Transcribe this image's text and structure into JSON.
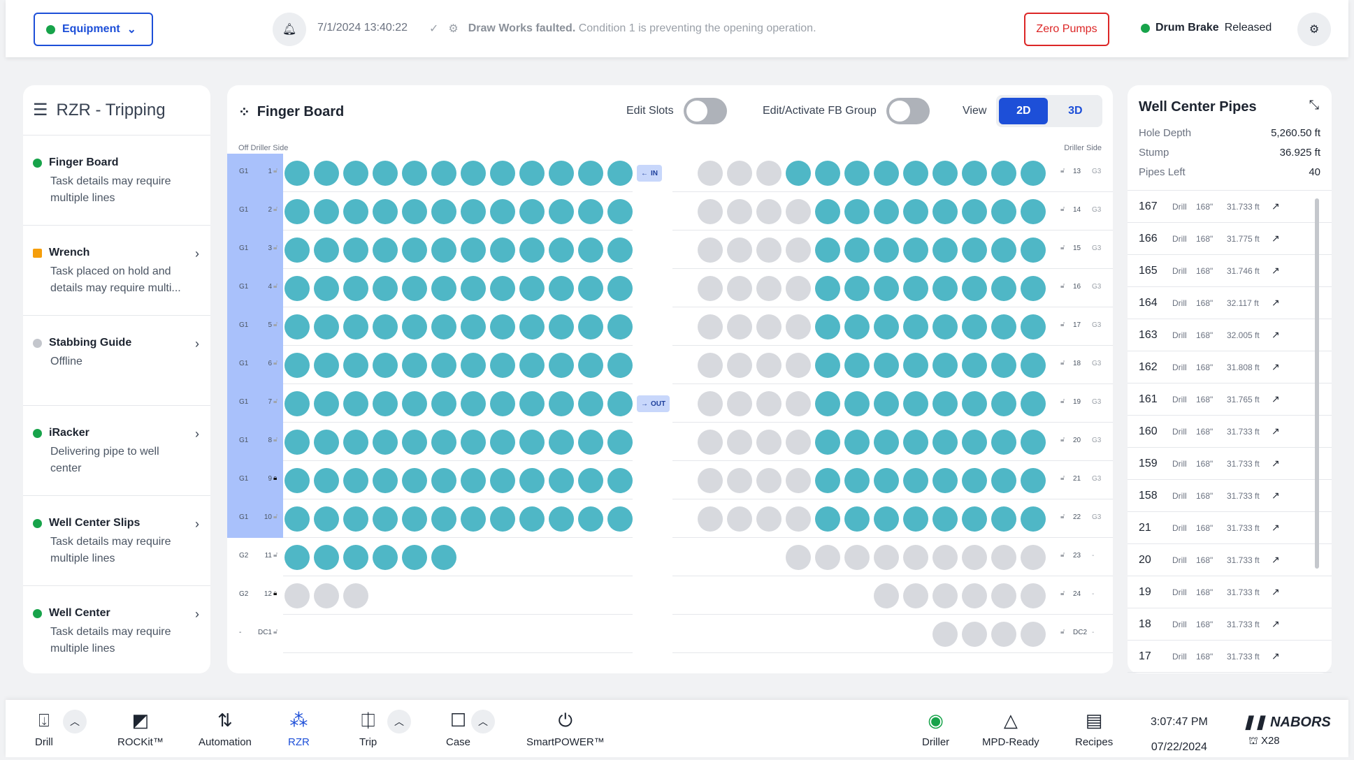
{
  "header": {
    "equipment_label": "Equipment",
    "timestamp": "7/1/2024  13:40:22",
    "fault_title": "Draw Works faulted.",
    "fault_detail": "Condition 1 is preventing the opening operation.",
    "zero_pumps": "Zero Pumps",
    "drum_label": "Drum Brake",
    "drum_state": "Released"
  },
  "left": {
    "title": "RZR - Tripping",
    "items": [
      {
        "title": "Finger Board",
        "desc": "Task details may require multiple lines",
        "status": "green"
      },
      {
        "title": "Wrench",
        "desc": "Task placed on hold and details may require multi...",
        "status": "orange"
      },
      {
        "title": "Stabbing Guide",
        "desc": "Offline",
        "status": "gray"
      },
      {
        "title": "iRacker",
        "desc": "Delivering pipe to well center",
        "status": "green"
      },
      {
        "title": "Well Center Slips",
        "desc": "Task details may require multiple lines",
        "status": "green"
      },
      {
        "title": "Well Center",
        "desc": "Task details may require multiple lines",
        "status": "green"
      }
    ]
  },
  "fingerboard": {
    "title": "Finger Board",
    "edit_slots": "Edit Slots",
    "edit_group": "Edit/Activate FB Group",
    "view": "View",
    "view_2d": "2D",
    "view_3d": "3D",
    "off_driller": "Off Driller Side",
    "driller": "Driller Side",
    "tag_in": "IN",
    "tag_out": "OUT",
    "rows": [
      {
        "g": "G1",
        "n": "1",
        "lock": "open",
        "lt": 12,
        "rg": 3,
        "rt": 9,
        "rn": "13",
        "rgp": "G3",
        "hl": true
      },
      {
        "g": "G1",
        "n": "2",
        "lock": "open",
        "lt": 12,
        "rg": 4,
        "rt": 8,
        "rn": "14",
        "rgp": "G3",
        "hl": true
      },
      {
        "g": "G1",
        "n": "3",
        "lock": "open",
        "lt": 12,
        "rg": 4,
        "rt": 8,
        "rn": "15",
        "rgp": "G3",
        "hl": true
      },
      {
        "g": "G1",
        "n": "4",
        "lock": "open",
        "lt": 12,
        "rg": 4,
        "rt": 8,
        "rn": "16",
        "rgp": "G3",
        "hl": true
      },
      {
        "g": "G1",
        "n": "5",
        "lock": "open",
        "lt": 12,
        "rg": 4,
        "rt": 8,
        "rn": "17",
        "rgp": "G3",
        "hl": true
      },
      {
        "g": "G1",
        "n": "6",
        "lock": "open",
        "lt": 12,
        "rg": 4,
        "rt": 8,
        "rn": "18",
        "rgp": "G3",
        "hl": true
      },
      {
        "g": "G1",
        "n": "7",
        "lock": "open",
        "lt": 12,
        "rg": 4,
        "rt": 8,
        "rn": "19",
        "rgp": "G3",
        "hl": true
      },
      {
        "g": "G1",
        "n": "8",
        "lock": "open",
        "lt": 12,
        "rg": 4,
        "rt": 8,
        "rn": "20",
        "rgp": "G3",
        "hl": true
      },
      {
        "g": "G1",
        "n": "9",
        "lock": "closed",
        "lt": 12,
        "rg": 4,
        "rt": 8,
        "rn": "21",
        "rgp": "G3",
        "hl": true
      },
      {
        "g": "G1",
        "n": "10",
        "lock": "open",
        "lt": 12,
        "rg": 4,
        "rt": 8,
        "rn": "22",
        "rgp": "G3",
        "hl": true
      },
      {
        "g": "G2",
        "n": "11",
        "lock": "open",
        "lt": 6,
        "rg": 9,
        "rt": 0,
        "rn": "23",
        "rgp": "-",
        "hl": false
      },
      {
        "g": "G2",
        "n": "12",
        "lock": "closed",
        "lt": 0,
        "lg": 3,
        "rg": 6,
        "rt": 0,
        "rn": "24",
        "rgp": "-",
        "hl": false
      },
      {
        "g": "-",
        "n": "DC1",
        "lock": "open",
        "lt": 0,
        "rg": 4,
        "rt": 0,
        "rn": "DC2",
        "rgp": "-",
        "hl": false
      }
    ]
  },
  "wellcenter": {
    "title": "Well Center Pipes",
    "hole_depth_k": "Hole Depth",
    "hole_depth_v": "5,260.50 ft",
    "stump_k": "Stump",
    "stump_v": "36.925 ft",
    "pipes_left_k": "Pipes Left",
    "pipes_left_v": "40",
    "pipes": [
      [
        "167",
        "Drill",
        "168\"",
        "31.733 ft"
      ],
      [
        "166",
        "Drill",
        "168\"",
        "31.775 ft"
      ],
      [
        "165",
        "Drill",
        "168\"",
        "31.746 ft"
      ],
      [
        "164",
        "Drill",
        "168\"",
        "32.117 ft"
      ],
      [
        "163",
        "Drill",
        "168\"",
        "32.005 ft"
      ],
      [
        "162",
        "Drill",
        "168\"",
        "31.808 ft"
      ],
      [
        "161",
        "Drill",
        "168\"",
        "31.765 ft"
      ],
      [
        "160",
        "Drill",
        "168\"",
        "31.733 ft"
      ],
      [
        "159",
        "Drill",
        "168\"",
        "31.733 ft"
      ],
      [
        "158",
        "Drill",
        "168\"",
        "31.733 ft"
      ],
      [
        "21",
        "Drill",
        "168\"",
        "31.733 ft"
      ],
      [
        "20",
        "Drill",
        "168\"",
        "31.733 ft"
      ],
      [
        "19",
        "Drill",
        "168\"",
        "31.733 ft"
      ],
      [
        "18",
        "Drill",
        "168\"",
        "31.733 ft"
      ],
      [
        "17",
        "Drill",
        "168\"",
        "31.733 ft"
      ]
    ]
  },
  "bottom": {
    "drill": "Drill",
    "rockit": "ROCKit™",
    "automation": "Automation",
    "rzr": "RZR",
    "trip": "Trip",
    "case": "Case",
    "smartpower": "SmartPOWER™",
    "driller": "Driller",
    "mpd": "MPD-Ready",
    "recipes": "Recipes",
    "time": "3:07:47 PM",
    "date": "07/22/2024",
    "brand": "NABORS",
    "rig": "X28"
  }
}
